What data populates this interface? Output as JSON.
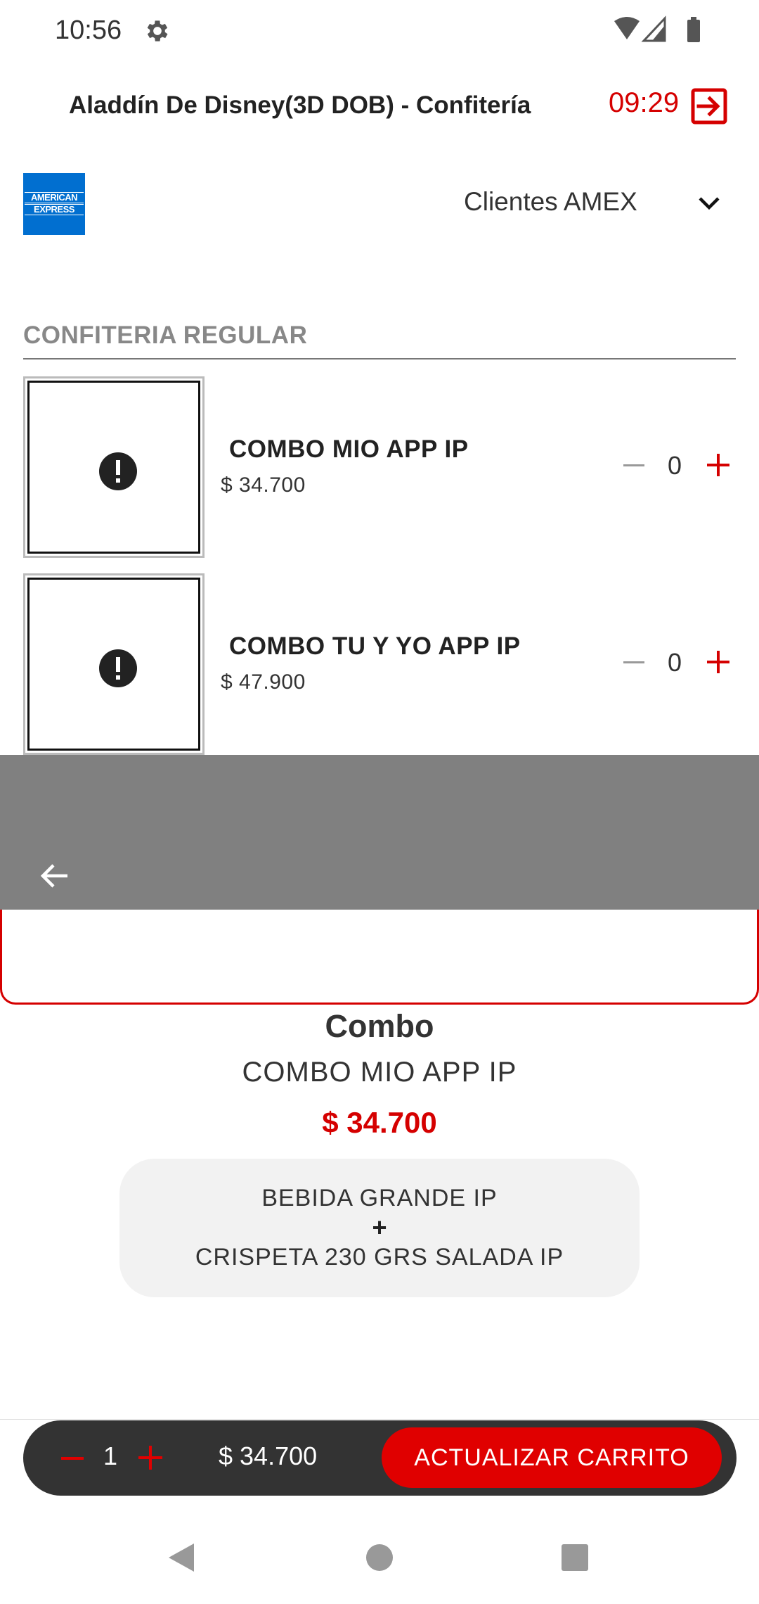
{
  "status_bar": {
    "time": "10:56"
  },
  "header": {
    "title": "Aladdín De Disney(3D DOB) - Confitería",
    "timer": "09:29"
  },
  "card": {
    "brand_line1": "AMERICAN",
    "brand_line2": "EXPRESS",
    "selected": "Clientes AMEX"
  },
  "section": {
    "title": "CONFITERIA REGULAR"
  },
  "products": [
    {
      "name": "COMBO MIO APP IP",
      "price": "$ 34.700",
      "qty": "0"
    },
    {
      "name": "COMBO TU Y YO APP IP",
      "price": "$ 47.900",
      "qty": "0"
    }
  ],
  "detail": {
    "type": "Combo",
    "name": "COMBO MIO APP IP",
    "price": "$ 34.700",
    "components": {
      "first": "BEBIDA  GRANDE IP",
      "plus": "+",
      "second": "CRISPETA 230 GRS SALADA IP"
    }
  },
  "cart": {
    "qty": "1",
    "total": "$ 34.700",
    "button_label": "ACTUALIZAR CARRITO"
  },
  "colors": {
    "accent": "#d50000",
    "amex": "#016fd0",
    "overlay": "#808080",
    "cart_bar": "#333333"
  }
}
